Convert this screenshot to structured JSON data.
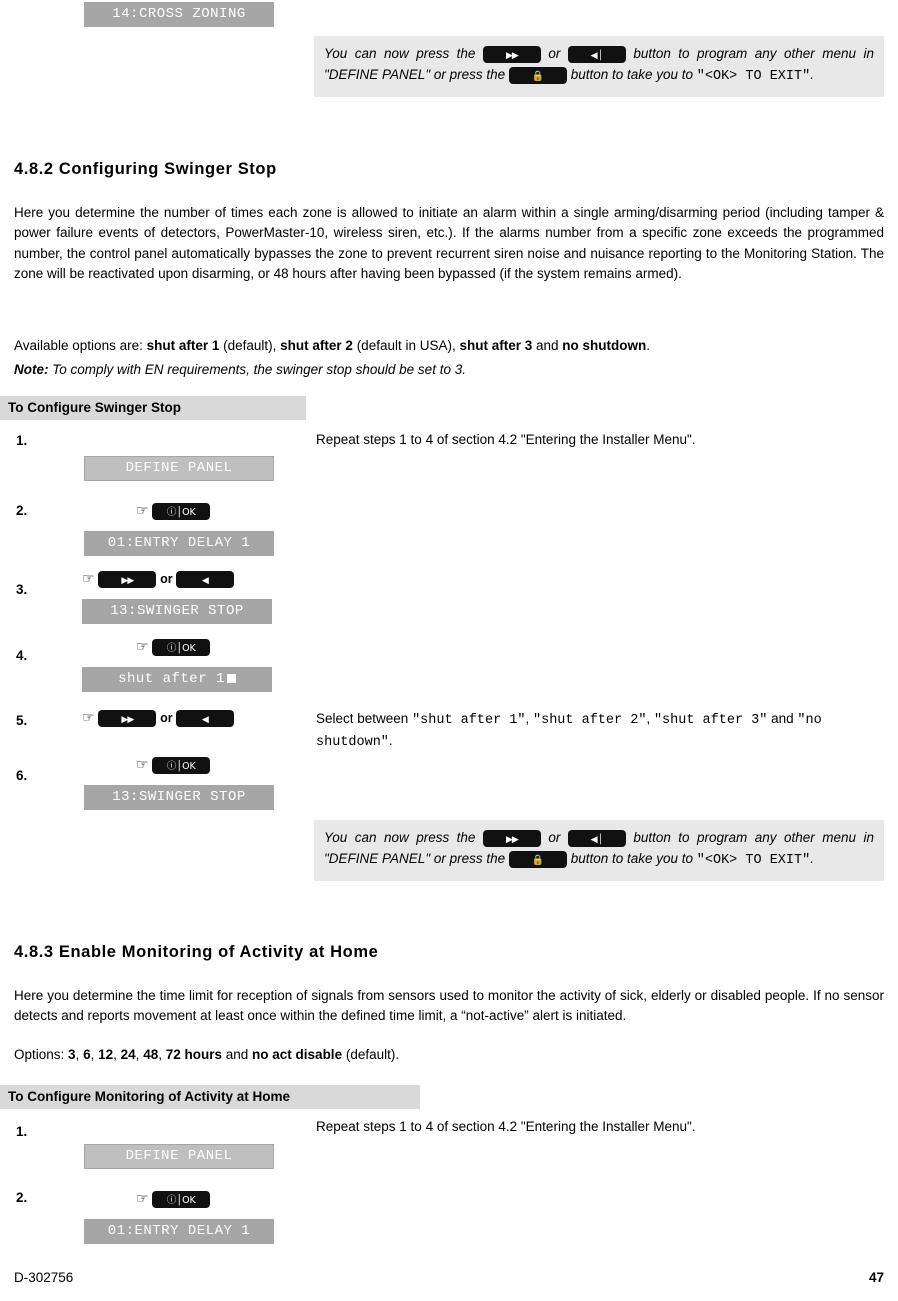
{
  "doc": {
    "footer_code": "D-302756",
    "page_number": "47"
  },
  "top_block": {
    "lcd": "14:CROSS ZONING",
    "note": {
      "part1": "You can now press the ",
      "or": " or ",
      "part2": " button to program any other menu in ",
      "define_panel": "\"DEFINE  PANEL\"",
      "part3": " or press the ",
      "part4": " button to take you to ",
      "exit": "\"<OK> TO EXIT\"",
      "period": "."
    }
  },
  "section_482": {
    "heading": "4.8.2 Configuring Swinger Stop",
    "paragraph": "Here you determine the number of times each zone is allowed to initiate an alarm within a single arming/disarming period (including tamper & power failure events of detectors, PowerMaster-10, wireless siren, etc.). If the alarms number from a specific zone exceeds the programmed number, the control panel automatically bypasses the zone to prevent recurrent siren noise and nuisance reporting to the Monitoring Station. The zone will be reactivated upon disarming, or 48 hours after having been bypassed (if the system remains armed).",
    "options_prefix": "Available options are: ",
    "options": [
      {
        "name": "shut after 1",
        "suffix": " (default), "
      },
      {
        "name": "shut after 2",
        "suffix": " (default in USA), "
      },
      {
        "name": "shut after 3",
        "suffix": " and "
      },
      {
        "name": "no shutdown",
        "suffix": "."
      }
    ],
    "note_label": "Note:",
    "note_text": " To comply with EN requirements, the swinger stop should be set to 3.",
    "banner": "To Configure Swinger Stop",
    "repeat_instruction": "Repeat steps 1 to 4 of section 4.2 \"Entering the Installer Menu\".",
    "steps": [
      {
        "num": "1.",
        "lcd": "DEFINE PANEL"
      },
      {
        "num": "2.",
        "lcd": "01:ENTRY DELAY 1"
      },
      {
        "num": "3.",
        "lcd": "13:SWINGER STOP",
        "or": "or"
      },
      {
        "num": "4.",
        "lcd": "shut after 1"
      },
      {
        "num": "5.",
        "or": "or"
      },
      {
        "num": "6.",
        "lcd": "13:SWINGER STOP"
      }
    ],
    "select_text": {
      "prefix": "Select between ",
      "opt1": "\"shut after 1\"",
      "sep1": ", ",
      "opt2": "\"shut after 2\"",
      "sep2": ", ",
      "opt3": "\"shut after 3\"",
      "sep3": " and ",
      "opt4": "\"no shutdown\"",
      "end": "."
    },
    "note2": {
      "part1": "You can now press the ",
      "or": " or ",
      "part2": " button to program any other menu in ",
      "define_panel": "\"DEFINE  PANEL\"",
      "part3": " or press the ",
      "part4": " button to take you to ",
      "exit": "\"<OK> TO EXIT\"",
      "period": "."
    }
  },
  "section_483": {
    "heading": "4.8.3 Enable Monitoring of Activity at Home",
    "paragraph": "Here you determine the time limit for reception of signals from sensors used to monitor the activity of sick, elderly or disabled people. If no sensor detects and reports movement at least once within the defined time limit, a “not-active” alert is initiated.",
    "options_prefix": "Options: ",
    "options": [
      {
        "name": "3",
        "suffix": ", "
      },
      {
        "name": "6",
        "suffix": ", "
      },
      {
        "name": "12",
        "suffix": ", "
      },
      {
        "name": "24",
        "suffix": ", "
      },
      {
        "name": "48",
        "suffix": ", "
      },
      {
        "name": "72 hours",
        "suffix": " and "
      },
      {
        "name": "no act disable",
        "suffix": " (default)."
      }
    ],
    "banner": "To Configure Monitoring of Activity at Home",
    "repeat_instruction": "Repeat steps 1 to 4 of section 4.2 \"Entering the Installer Menu\".",
    "steps": [
      {
        "num": "1.",
        "lcd": "DEFINE PANEL"
      },
      {
        "num": "2.",
        "lcd": "01:ENTRY DELAY 1"
      }
    ]
  },
  "icons": {
    "hand": "☞",
    "next_key": "next-key",
    "back_key": "back-key",
    "ok_key": "ok-key",
    "lock_key": "lock-key"
  }
}
